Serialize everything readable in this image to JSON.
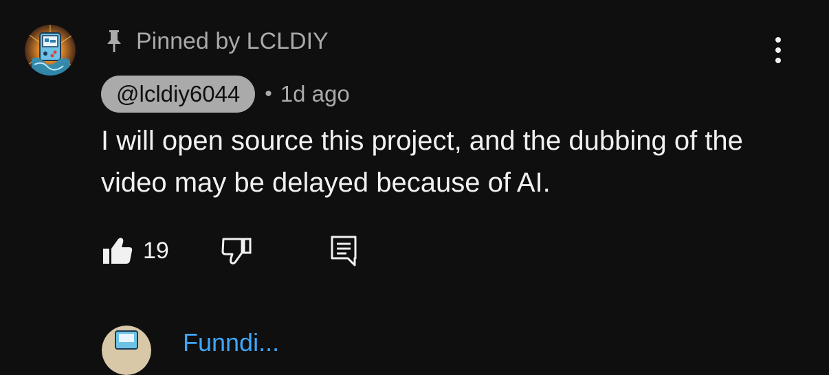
{
  "comment": {
    "pinned_label": "Pinned by LCLDIY",
    "author_handle": "@lcldiy6044",
    "separator": "•",
    "timestamp": "1d ago",
    "text": "I will open source this project, and the dubbing of the video may be delayed because of AI.",
    "like_count": "19",
    "icons": {
      "pin": "pin-icon",
      "more": "more-vert-icon",
      "like": "thumb-up-filled-icon",
      "dislike": "thumb-down-icon",
      "reply": "reply-icon"
    },
    "colors": {
      "background": "#0f0f0f",
      "text": "#f1f1f1",
      "secondary_text": "#aaaaaa",
      "handle_chip": "#aaaaaa"
    }
  },
  "next_comment": {
    "author_partial": "Funndi..."
  }
}
